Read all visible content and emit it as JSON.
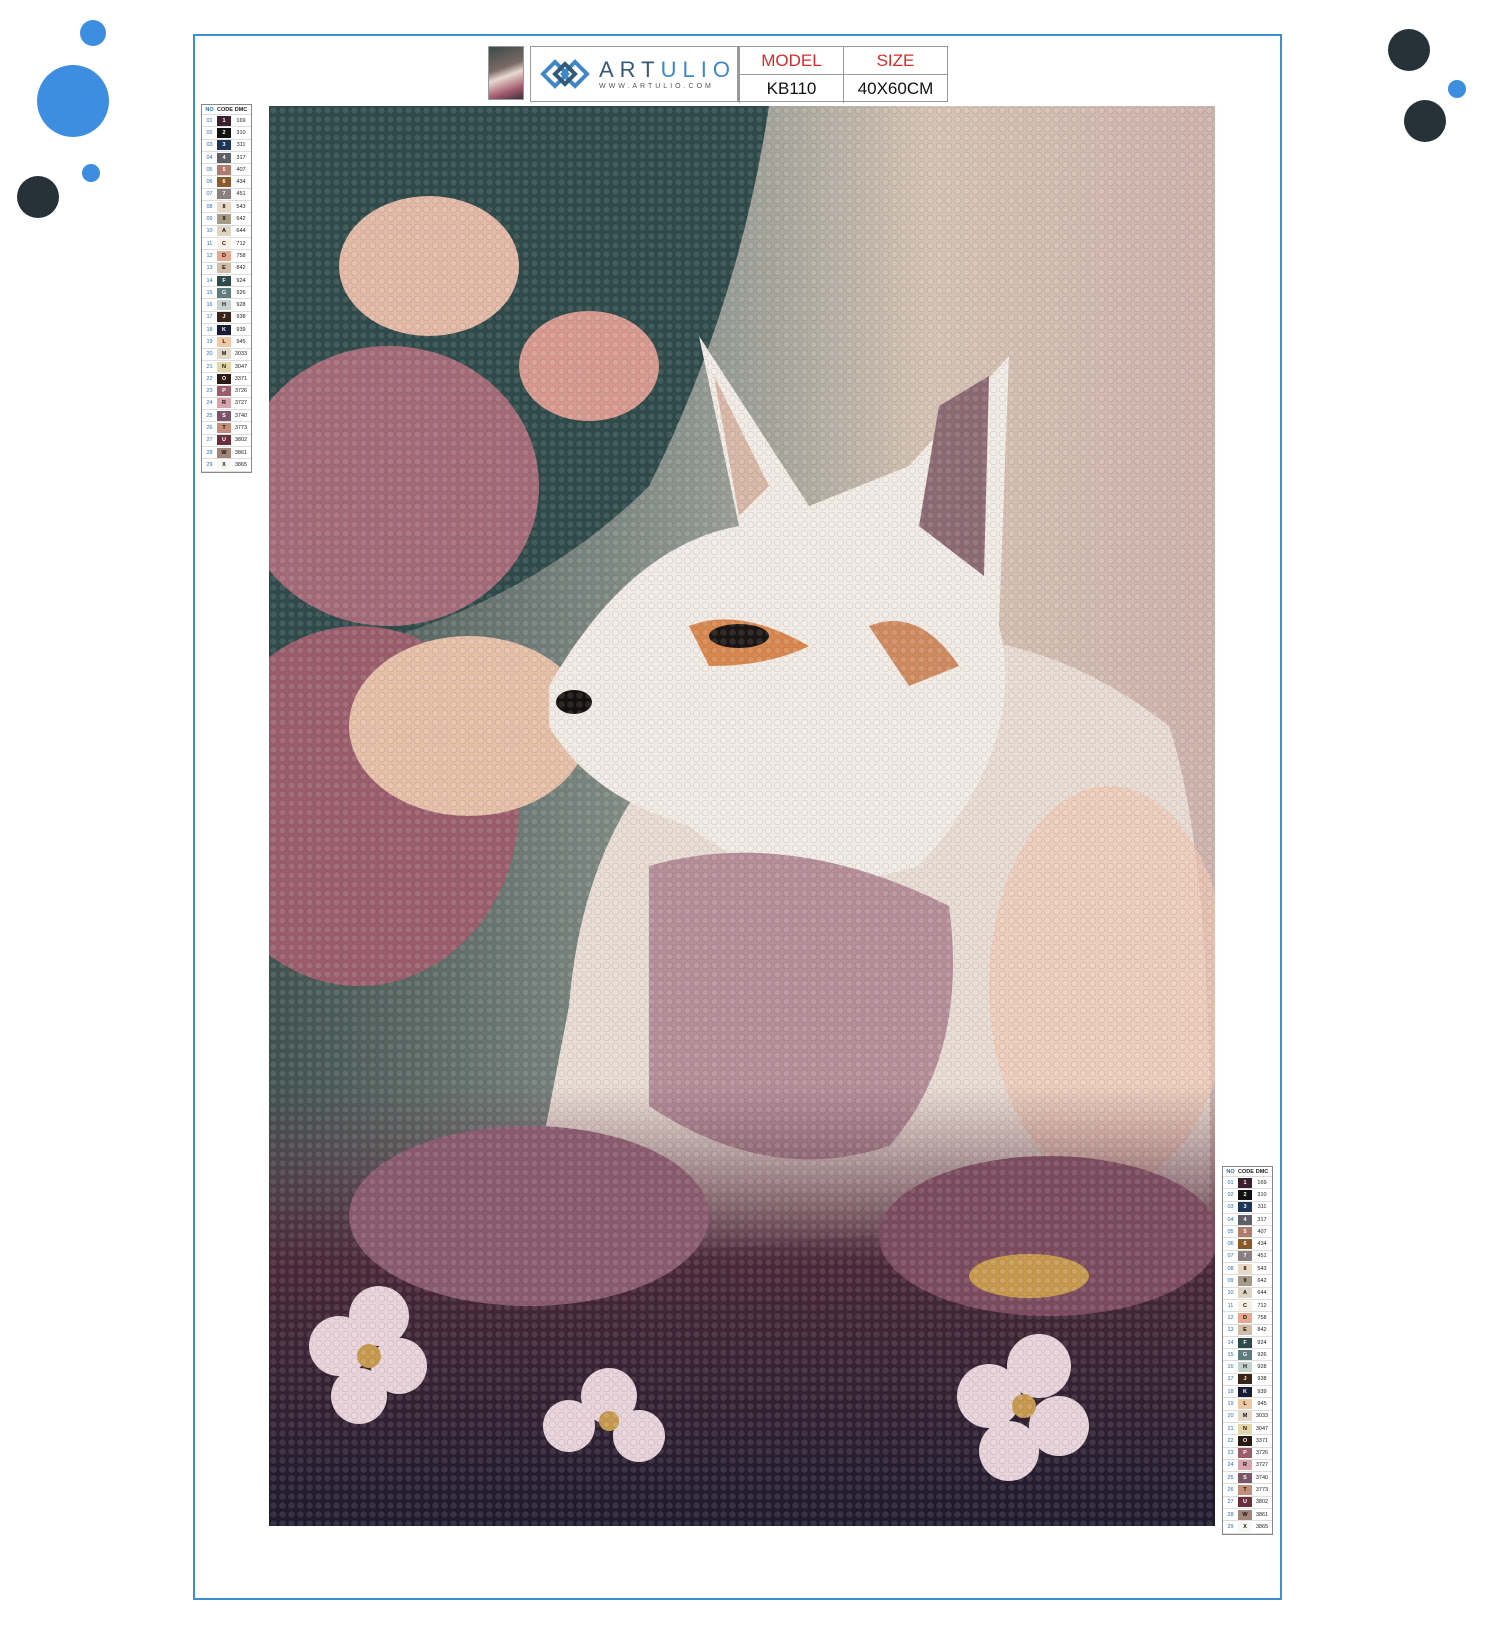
{
  "brand": {
    "name_part1": "ART",
    "name_part2": "ULIO",
    "url": "WWW.ARTULIO.COM"
  },
  "spec": {
    "model_label": "MODEL",
    "model_value": "KB110",
    "size_label": "SIZE",
    "size_value": "40X60CM"
  },
  "legend_headers": {
    "no": "NO",
    "code": "CODE",
    "dmc": "DMC"
  },
  "legend": [
    {
      "no": "01",
      "code": "1",
      "dmc": "169",
      "color": "#3b1f2e"
    },
    {
      "no": "02",
      "code": "2",
      "dmc": "310",
      "color": "#111111"
    },
    {
      "no": "03",
      "code": "3",
      "dmc": "311",
      "color": "#1d3557"
    },
    {
      "no": "04",
      "code": "4",
      "dmc": "317",
      "color": "#5f5f66"
    },
    {
      "no": "05",
      "code": "5",
      "dmc": "407",
      "color": "#b07a6c"
    },
    {
      "no": "06",
      "code": "6",
      "dmc": "434",
      "color": "#8a5a2b"
    },
    {
      "no": "07",
      "code": "7",
      "dmc": "451",
      "color": "#8c7f7f"
    },
    {
      "no": "08",
      "code": "8",
      "dmc": "543",
      "color": "#ead7c6"
    },
    {
      "no": "09",
      "code": "9",
      "dmc": "642",
      "color": "#a59a85"
    },
    {
      "no": "10",
      "code": "A",
      "dmc": "644",
      "color": "#ddd5c2"
    },
    {
      "no": "11",
      "code": "C",
      "dmc": "712",
      "color": "#f6efe2"
    },
    {
      "no": "12",
      "code": "D",
      "dmc": "758",
      "color": "#e7a790"
    },
    {
      "no": "13",
      "code": "E",
      "dmc": "842",
      "color": "#d2bca5"
    },
    {
      "no": "14",
      "code": "F",
      "dmc": "924",
      "color": "#2f4a4a"
    },
    {
      "no": "15",
      "code": "G",
      "dmc": "926",
      "color": "#5f7d7c"
    },
    {
      "no": "16",
      "code": "H",
      "dmc": "928",
      "color": "#c6d0cd"
    },
    {
      "no": "17",
      "code": "J",
      "dmc": "938",
      "color": "#3a2418"
    },
    {
      "no": "18",
      "code": "K",
      "dmc": "939",
      "color": "#171b33"
    },
    {
      "no": "19",
      "code": "L",
      "dmc": "945",
      "color": "#f0c8a4"
    },
    {
      "no": "20",
      "code": "M",
      "dmc": "3033",
      "color": "#e2d6c5"
    },
    {
      "no": "21",
      "code": "N",
      "dmc": "3047",
      "color": "#e5d6a8"
    },
    {
      "no": "22",
      "code": "O",
      "dmc": "3371",
      "color": "#2a1a10"
    },
    {
      "no": "23",
      "code": "P",
      "dmc": "3726",
      "color": "#9b5d6c"
    },
    {
      "no": "24",
      "code": "R",
      "dmc": "3727",
      "color": "#d9a3ad"
    },
    {
      "no": "25",
      "code": "S",
      "dmc": "3740",
      "color": "#7c5568"
    },
    {
      "no": "26",
      "code": "T",
      "dmc": "3773",
      "color": "#c48e78"
    },
    {
      "no": "27",
      "code": "U",
      "dmc": "3802",
      "color": "#6b2e3d"
    },
    {
      "no": "28",
      "code": "W",
      "dmc": "3861",
      "color": "#a4857a"
    },
    {
      "no": "29",
      "code": "X",
      "dmc": "3865",
      "color": "#f9f7f3"
    }
  ],
  "colors": {
    "border": "#3c8fd0",
    "accent_blue": "#3d8ee0",
    "dark_dot": "#263238",
    "label_red": "#d42a2a"
  }
}
